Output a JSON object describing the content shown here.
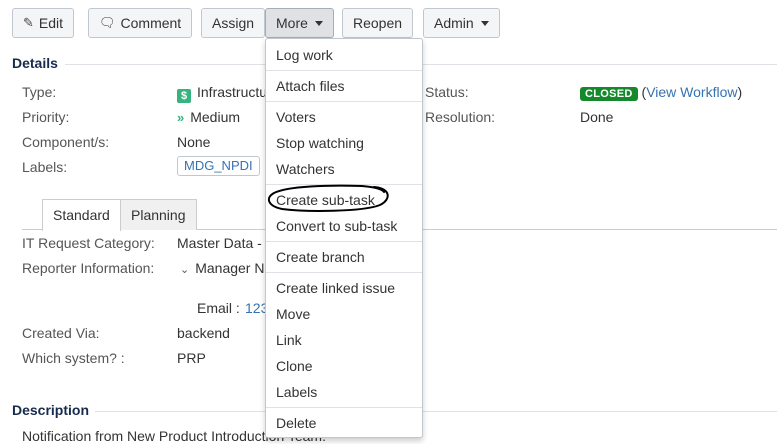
{
  "toolbar": {
    "edit": "Edit",
    "comment": "Comment",
    "assign": "Assign",
    "more": "More",
    "reopen": "Reopen",
    "admin": "Admin"
  },
  "details": {
    "title": "Details",
    "type_label": "Type:",
    "type_value": "Infrastructu",
    "priority_label": "Priority:",
    "priority_value": "Medium",
    "components_label": "Component/s:",
    "components_value": "None",
    "labels_label": "Labels:",
    "labels_value": "MDG_NPDI",
    "status_label": "Status:",
    "status_value": "CLOSED",
    "view_workflow": "View Workflow",
    "resolution_label": "Resolution:",
    "resolution_value": "Done"
  },
  "tabs": {
    "standard": "Standard",
    "planning": "Planning"
  },
  "fields": {
    "it_request_label": "IT Request Category:",
    "it_request_value": "Master Data -",
    "reporter_label": "Reporter Information:",
    "reporter_value": "Manager N",
    "email_label": "Email :",
    "email_value": "123",
    "created_via_label": "Created Via:",
    "created_via_value": "backend",
    "which_system_label": "Which system? :",
    "which_system_value": "PRP"
  },
  "description": {
    "title": "Description",
    "text": "Notification from New Product Introduction Team:"
  },
  "more_menu": {
    "items": [
      "Log work",
      "Attach files",
      "Voters",
      "Stop watching",
      "Watchers",
      "Create sub-task",
      "Convert to sub-task",
      "Create branch",
      "Create linked issue",
      "Move",
      "Link",
      "Clone",
      "Labels",
      "Delete"
    ]
  },
  "icons": {
    "edit": "pencil-icon",
    "comment": "comment-bubble-icon",
    "type": "dollar-badge-icon",
    "priority": "double-chevron-down-icon"
  },
  "colors": {
    "status_closed": "#14892c",
    "link": "#3572b0",
    "type_badge": "#36b37e"
  }
}
